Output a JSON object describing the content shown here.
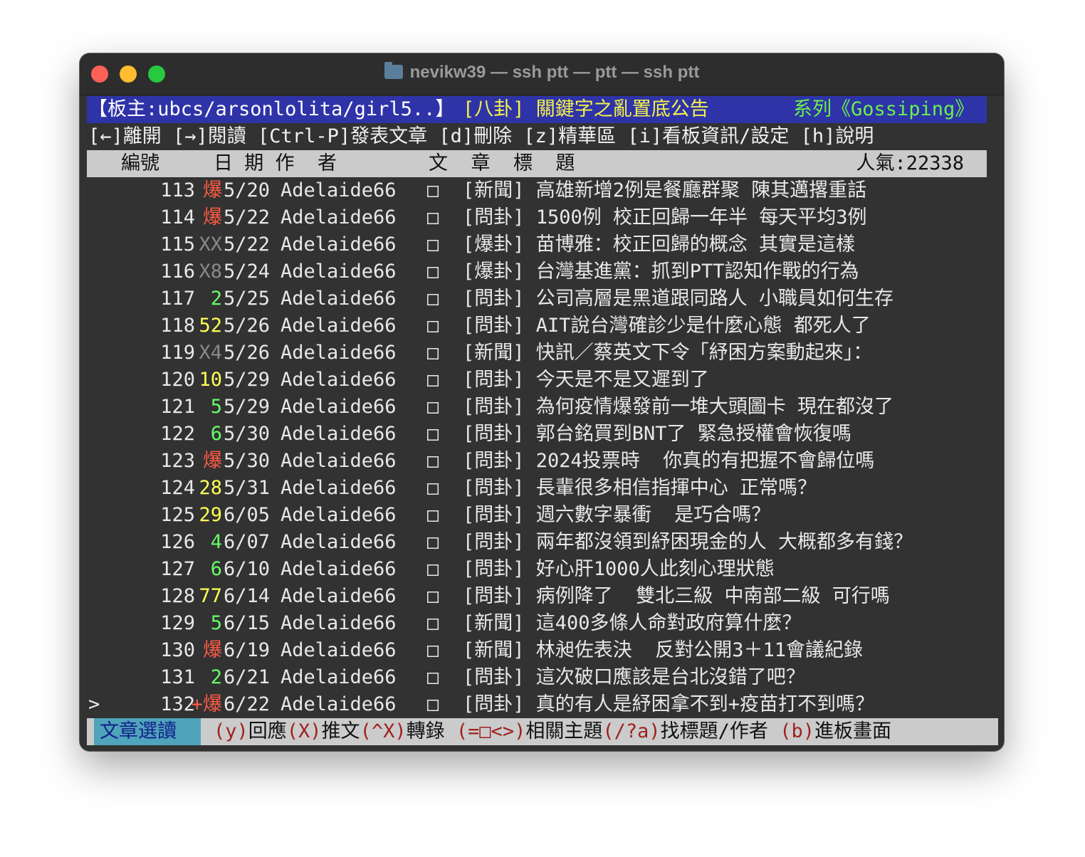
{
  "window": {
    "title": "nevikw39 — ssh ptt — ptt — ssh ptt",
    "folder_icon": "folder-icon"
  },
  "header": {
    "moderators": "【板主:ubcs/arsonlolita/girl5..】",
    "notice": "[八卦] 關鍵字之亂置底公告",
    "series": "系列《Gossiping》"
  },
  "menu": "[←]離開 [→]閱讀 [Ctrl-P]發表文章 [d]刪除 [z]精華區 [i]看板資訊/設定 [h]說明",
  "columns": {
    "number": "編號",
    "date_author": "日 期 作  者",
    "title": "文  章  標  題",
    "popularity": "人氣:22338"
  },
  "rows": [
    {
      "num": "113",
      "score": "爆",
      "score_color": "red",
      "date": "5/20",
      "author": "Adelaide66",
      "mark": "□",
      "title": "[新聞] 高雄新增2例是餐廳群聚 陳其邁撂重話"
    },
    {
      "num": "114",
      "score": "爆",
      "score_color": "red",
      "date": "5/22",
      "author": "Adelaide66",
      "mark": "□",
      "title": "[問卦] 1500例 校正回歸一年半 每天平均3例"
    },
    {
      "num": "115",
      "score": "XX",
      "score_color": "gray",
      "date": "5/22",
      "author": "Adelaide66",
      "mark": "□",
      "title": "[爆卦] 苗博雅：校正回歸的概念 其實是這樣"
    },
    {
      "num": "116",
      "score": "X8",
      "score_color": "gray",
      "date": "5/24",
      "author": "Adelaide66",
      "mark": "□",
      "title": "[爆卦] 台灣基進黨：抓到PTT認知作戰的行為"
    },
    {
      "num": "117",
      "score": "2",
      "score_color": "green",
      "date": "5/25",
      "author": "Adelaide66",
      "mark": "□",
      "title": "[問卦] 公司高層是黑道跟同路人 小職員如何生存"
    },
    {
      "num": "118",
      "score": "52",
      "score_color": "yellow",
      "date": "5/26",
      "author": "Adelaide66",
      "mark": "□",
      "title": "[問卦] AIT說台灣確診少是什麼心態 都死人了"
    },
    {
      "num": "119",
      "score": "X4",
      "score_color": "gray",
      "date": "5/26",
      "author": "Adelaide66",
      "mark": "□",
      "title": "[新聞] 快訊／蔡英文下令「紓困方案動起來」："
    },
    {
      "num": "120",
      "score": "10",
      "score_color": "yellow",
      "date": "5/29",
      "author": "Adelaide66",
      "mark": "□",
      "title": "[問卦] 今天是不是又遲到了"
    },
    {
      "num": "121",
      "score": "5",
      "score_color": "green",
      "date": "5/29",
      "author": "Adelaide66",
      "mark": "□",
      "title": "[問卦] 為何疫情爆發前一堆大頭圖卡 現在都沒了"
    },
    {
      "num": "122",
      "score": "6",
      "score_color": "green",
      "date": "5/30",
      "author": "Adelaide66",
      "mark": "□",
      "title": "[問卦] 郭台銘買到BNT了 緊急授權會恢復嗎"
    },
    {
      "num": "123",
      "score": "爆",
      "score_color": "red",
      "date": "5/30",
      "author": "Adelaide66",
      "mark": "□",
      "title": "[問卦] 2024投票時  你真的有把握不會歸位嗎"
    },
    {
      "num": "124",
      "score": "28",
      "score_color": "yellow",
      "date": "5/31",
      "author": "Adelaide66",
      "mark": "□",
      "title": "[問卦] 長輩很多相信指揮中心 正常嗎？"
    },
    {
      "num": "125",
      "score": "29",
      "score_color": "yellow",
      "date": "6/05",
      "author": "Adelaide66",
      "mark": "□",
      "title": "[問卦] 週六數字暴衝  是巧合嗎？"
    },
    {
      "num": "126",
      "score": "4",
      "score_color": "green",
      "date": "6/07",
      "author": "Adelaide66",
      "mark": "□",
      "title": "[問卦] 兩年都沒領到紓困現金的人 大概都多有錢？"
    },
    {
      "num": "127",
      "score": "6",
      "score_color": "green",
      "date": "6/10",
      "author": "Adelaide66",
      "mark": "□",
      "title": "[問卦] 好心肝1000人此刻心理狀態"
    },
    {
      "num": "128",
      "score": "77",
      "score_color": "yellow",
      "date": "6/14",
      "author": "Adelaide66",
      "mark": "□",
      "title": "[問卦] 病例降了  雙北三級 中南部二級 可行嗎"
    },
    {
      "num": "129",
      "score": "5",
      "score_color": "green",
      "date": "6/15",
      "author": "Adelaide66",
      "mark": "□",
      "title": "[新聞] 這400多條人命對政府算什麼？"
    },
    {
      "num": "130",
      "score": "爆",
      "score_color": "red",
      "date": "6/19",
      "author": "Adelaide66",
      "mark": "□",
      "title": "[新聞] 林昶佐表決  反對公開3＋11會議紀錄"
    },
    {
      "num": "131",
      "score": "2",
      "score_color": "green",
      "date": "6/21",
      "author": "Adelaide66",
      "mark": "□",
      "title": "[問卦] 這次破口應該是台北沒錯了吧？"
    },
    {
      "num": "132",
      "score": "+爆",
      "score_color": "red",
      "date": "6/22",
      "author": "Adelaide66",
      "mark": "□",
      "title": "[問卦] 真的有人是紓困拿不到+疫苗打不到嗎？",
      "cursor": ">"
    }
  ],
  "footer": {
    "mode": "文章選讀",
    "keys": [
      {
        "key": "(y)",
        "text": "回應"
      },
      {
        "key": "(X)",
        "text": "推文"
      },
      {
        "key": "(^X)",
        "text": "轉錄"
      },
      {
        "key": " (=□<>)",
        "text": "相關主題"
      },
      {
        "key": "(/?a)",
        "text": "找標題/作者"
      },
      {
        "key": " (b)",
        "text": "進板畫面"
      }
    ]
  },
  "colors": {
    "red": "#ff5a45",
    "yellow": "#ffff55",
    "green": "#66ff66",
    "gray": "#8a8a8a",
    "header_bg": "#2e33a8",
    "terminal_bg": "#323232"
  }
}
